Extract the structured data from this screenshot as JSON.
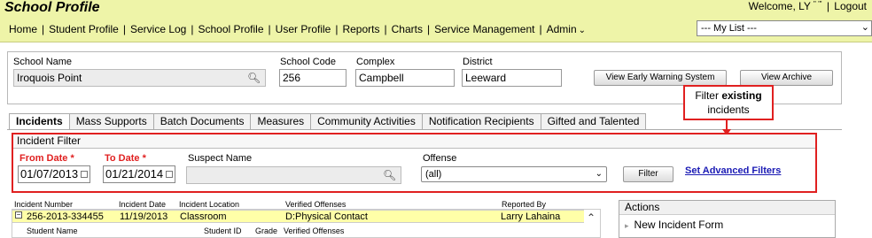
{
  "header": {
    "title": "School Profile",
    "welcome": "Welcome, LY",
    "welcome_extra": "\"   '\"",
    "logout": "Logout",
    "nav": [
      "Home",
      "Student Profile",
      "Service Log",
      "School Profile",
      "User Profile",
      "Reports",
      "Charts",
      "Service Management",
      "Admin"
    ],
    "my_list": "--- My List ---"
  },
  "school": {
    "name_label": "School Name",
    "name_value": "Iroquois Point",
    "code_label": "School Code",
    "code_value": "256",
    "complex_label": "Complex",
    "complex_value": "Campbell",
    "district_label": "District",
    "district_value": "Leeward",
    "early_warning_button": "View Early Warning System",
    "archive_button": "View Archive"
  },
  "callout": {
    "line1_pre": "Filter ",
    "line1_bold": "existing",
    "line2": "incidents"
  },
  "tabs": [
    "Incidents",
    "Mass Supports",
    "Batch Documents",
    "Measures",
    "Community Activities",
    "Notification Recipients",
    "Gifted and Talented"
  ],
  "filter": {
    "title": "Incident Filter",
    "from_label": "From Date *",
    "from_value": "01/07/2013",
    "to_label": "To Date *",
    "to_value": "01/21/2014",
    "suspect_label": "Suspect Name",
    "offense_label": "Offense",
    "offense_value": "(all)",
    "filter_button": "Filter",
    "advanced_link": "Set Advanced Filters"
  },
  "table": {
    "headers": [
      "Incident Number",
      "Incident Date",
      "Incident Location",
      "Verified Offenses",
      "Reported By"
    ],
    "row": {
      "number": "256-2013-334455",
      "date": "11/19/2013",
      "location": "Classroom",
      "offense": "D:Physical Contact",
      "reported_by": "Larry Lahaina"
    },
    "sub_headers": [
      "Student Name",
      "Student ID",
      "Grade",
      "Verified Offenses"
    ]
  },
  "actions": {
    "title": "Actions",
    "items": [
      "New Incident Form"
    ]
  }
}
